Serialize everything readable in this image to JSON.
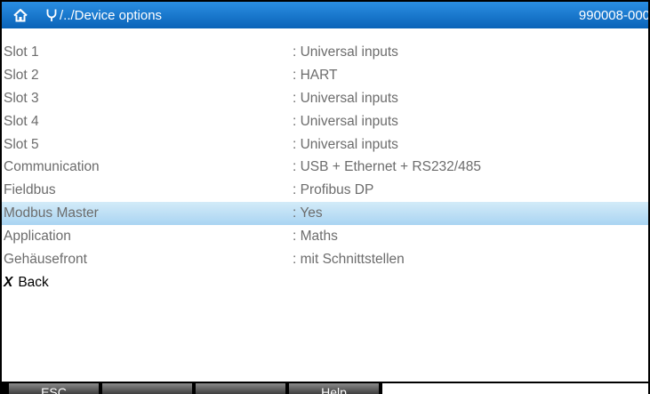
{
  "header": {
    "path_title": "/../Device options",
    "device_id": "990008-000"
  },
  "rows": [
    {
      "label": "Slot 1",
      "value": ": Universal inputs"
    },
    {
      "label": "Slot 2",
      "value": ": HART"
    },
    {
      "label": "Slot 3",
      "value": ": Universal inputs"
    },
    {
      "label": "Slot 4",
      "value": ": Universal inputs"
    },
    {
      "label": "Slot 5",
      "value": ": Universal inputs"
    },
    {
      "label": "Communication",
      "value": ": USB + Ethernet + RS232/485"
    },
    {
      "label": "Fieldbus",
      "value": ": Profibus DP"
    },
    {
      "label": "Modbus Master",
      "value": ": Yes"
    },
    {
      "label": "Application",
      "value": ": Maths"
    },
    {
      "label": "Gehäusefront",
      "value": ": mit Schnittstellen"
    }
  ],
  "back": {
    "glyph": "X",
    "label": "Back"
  },
  "softkeys": {
    "esc": "ESC",
    "key2": "",
    "key3": "",
    "help": "Help"
  }
}
